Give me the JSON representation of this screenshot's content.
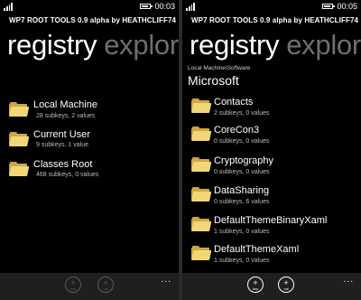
{
  "left": {
    "time": "00:03",
    "app_title": "WP7 ROOT TOOLS 0.9 alpha by HEATHCLIFF74",
    "pivot_active": "registry",
    "pivot_inactive": "explore",
    "items": [
      {
        "name": "Local Machine",
        "meta": "28 subkeys, 2 values"
      },
      {
        "name": "Current User",
        "meta": "9 subkeys, 1 value"
      },
      {
        "name": "Classes Root",
        "meta": "468 subkeys, 0 values"
      }
    ],
    "appbar": {
      "key_label": "key",
      "val_label": "val",
      "more": "..."
    }
  },
  "right": {
    "time": "00:05",
    "app_title": "WP7 ROOT TOOLS 0.9 alpha by HEATHCLIFF74",
    "pivot_active": "registry",
    "pivot_inactive": "explore",
    "path": "Local Machine\\Software",
    "heading": "Microsoft",
    "items": [
      {
        "name": "Contacts",
        "meta": "2 subkeys, 0 values"
      },
      {
        "name": "CoreCon3",
        "meta": "0 subkeys, 0 values"
      },
      {
        "name": "Cryptography",
        "meta": "0 subkeys, 0 values"
      },
      {
        "name": "DataSharing",
        "meta": "0 subkeys, 6 values"
      },
      {
        "name": "DefaultThemeBinaryXaml",
        "meta": "1 subkeys, 0 values"
      },
      {
        "name": "DefaultThemeXaml",
        "meta": "1 subkeys, 0 values"
      }
    ],
    "appbar": {
      "key_label": "key",
      "val_label": "val",
      "more": "..."
    }
  }
}
